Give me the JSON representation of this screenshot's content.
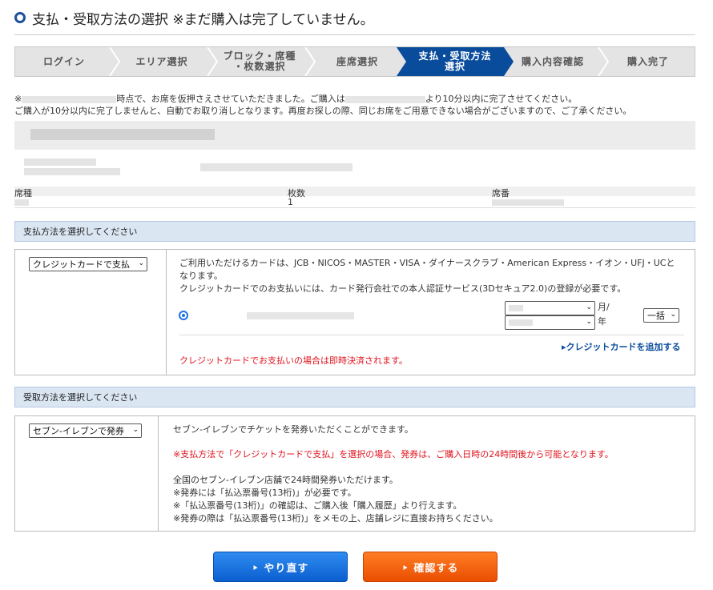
{
  "page": {
    "title": "支払・受取方法の選択 ※まだ購入は完了していません。"
  },
  "steps": [
    {
      "label": "ログイン",
      "active": false
    },
    {
      "label": "エリア選択",
      "active": false
    },
    {
      "label": "ブロック・席種\n・枚数選択",
      "active": false
    },
    {
      "label": "座席選択",
      "active": false
    },
    {
      "label": "支払・受取方法\n選択",
      "active": true
    },
    {
      "label": "購入内容確認",
      "active": false
    },
    {
      "label": "購入完了",
      "active": false
    }
  ],
  "notice": {
    "line1_prefix": "※",
    "line1_mid": "時点で、お席を仮押さえさせていただきました。ご購入は",
    "line1_suffix": "より10分以内に完了させてください。",
    "line2": "ご購入が10分以内に完了しませんと、自動でお取り消しとなります。再度お探しの際、同じお席をご用意できない場合がございますので、ご了承ください。"
  },
  "seat_table": {
    "headers": {
      "seat_type": "席種",
      "count": "枚数",
      "seat_number": "席番"
    },
    "count_value": "1"
  },
  "payment": {
    "section_title": "支払方法を選択してください",
    "method_selected": "クレジットカードで支払",
    "info_line1": "ご利用いただけるカードは、JCB・NICOS・MASTER・VISA・ダイナースクラブ・American Express・イオン・UFJ・UCと",
    "info_line2": "なります。",
    "info_line3": "クレジットカードでのお支払いには、カード発行会社での本人認証サービス(3Dセキュア2.0)の登録が必要です。",
    "month_label": "月/",
    "year_label": "年",
    "installment": "一括",
    "add_card_link": "▸クレジットカードを追加する",
    "immediate_note": "クレジットカードでお支払いの場合は即時決済されます。"
  },
  "pickup": {
    "section_title": "受取方法を選択してください",
    "method_selected": "セブン-イレブンで発券",
    "line1": "セブン-イレブンでチケットを発券いただくことができます。",
    "warning": "※支払方法で「クレジットカードで支払」を選択の場合、発券は、ご購入日時の24時間後から可能となります。",
    "line3": "全国のセブン-イレブン店舗で24時間発券いただけます。",
    "line4": "※発券には「払込票番号(13桁)」が必要です。",
    "line5": "※「払込票番号(13桁)」の確認は、ご購入後「購入履歴」より行えます。",
    "line6": "※発券の際は「払込票番号(13桁)」をメモの上、店舗レジに直接お持ちください。"
  },
  "buttons": {
    "retry": "‣ やり直す",
    "confirm": "‣ 確認する"
  },
  "colors": {
    "accent_blue": "#0a4c9c",
    "retry_button": "#0b5fd0",
    "confirm_button": "#ea4e00",
    "warning_red": "#e0141e",
    "section_bar": "#dbe6f3"
  }
}
